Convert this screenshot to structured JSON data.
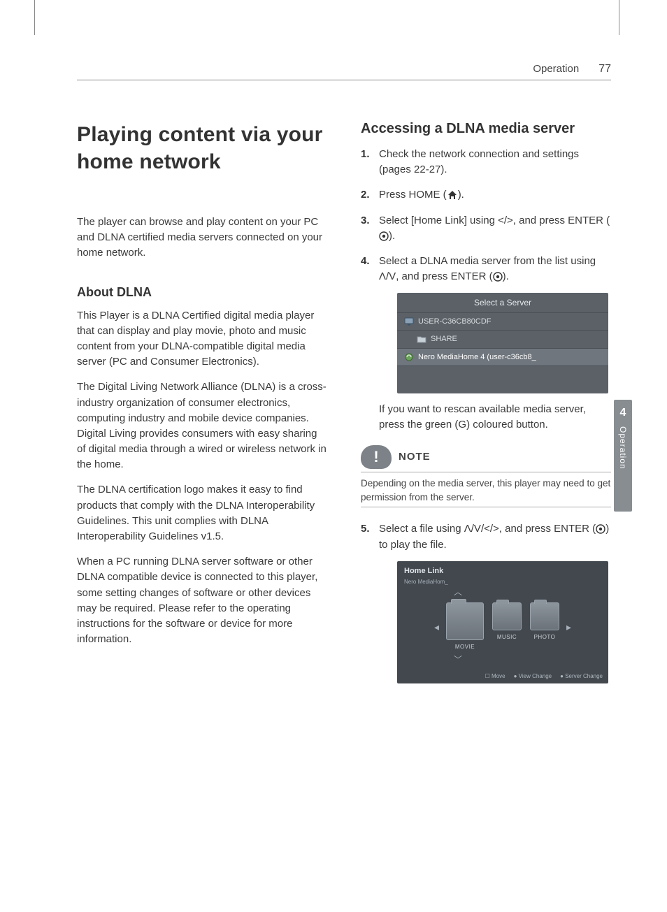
{
  "header": {
    "section": "Operation",
    "page": "77"
  },
  "sidetab": {
    "number": "4",
    "label": "Operation"
  },
  "left": {
    "title": "Playing content via your home network",
    "intro": "The player can browse and play content on your PC and DLNA certified media servers connected on your home network.",
    "about_heading": "About DLNA",
    "p1": "This Player is a DLNA Certified digital media player that can display and play movie, photo and music content from your DLNA-compatible digital media server (PC and Consumer Electronics).",
    "p2": "The Digital Living Network Alliance (DLNA) is a cross-industry organization of consumer electronics, computing industry and mobile device companies. Digital Living provides consumers with easy sharing of digital media through a wired or wireless network in the home.",
    "p3": "The DLNA certification logo makes it easy to find products that comply with the DLNA Interoperability Guidelines. This unit complies with DLNA Interoperability Guidelines v1.5.",
    "p4": "When a PC running DLNA server software or other DLNA compatible device is connected to this player, some setting changes of software or other devices may be required. Please refer to the operating instructions for the software or device for more information."
  },
  "right": {
    "heading": "Accessing a DLNA media server",
    "steps": {
      "s1": "Check the network connection and settings (pages 22-27).",
      "s2a": "Press HOME (",
      "s2b": ").",
      "s3a": "Select [Home Link] using ",
      "s3glyph": "</>",
      "s3b": ", and press ENTER (",
      "s3c": ").",
      "s4a": "Select a DLNA media server from the list using ",
      "s4glyph": "Λ/V",
      "s4b": ", and press ENTER (",
      "s4c": ").",
      "s5a": "Select a file using ",
      "s5glyph": "Λ/V/</>",
      "s5b": ", and press ENTER (",
      "s5c": ") to play the file."
    },
    "srv": {
      "title": "Select a Server",
      "r1": "USER-C36CB80CDF",
      "r2": "SHARE",
      "r3": "Nero MediaHome 4 (user-c36cb8_"
    },
    "rescan_a": "If you want to rescan available media server, press the green (",
    "rescan_g": "G",
    "rescan_b": ") coloured button.",
    "note": {
      "label": "NOTE",
      "text": "Depending on the media server, this player may need to get permission from the server."
    },
    "hl": {
      "title": "Home Link",
      "sub": "Nero MediaHom_",
      "f_movie": "MOVIE",
      "f_music": "MUSIC",
      "f_photo": "PHOTO",
      "foot1": "Move",
      "foot2": "View Change",
      "foot3": "Server Change"
    }
  }
}
